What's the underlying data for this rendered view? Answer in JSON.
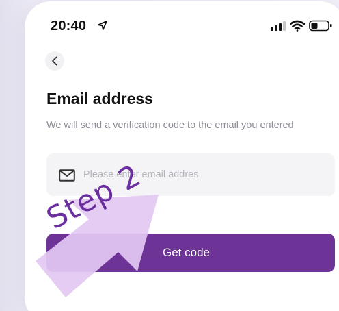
{
  "status_bar": {
    "time": "20:40",
    "location_icon": "location-arrow-icon",
    "signal_icon": "cellular-signal-icon",
    "wifi_icon": "wifi-icon",
    "battery_icon": "battery-icon"
  },
  "header": {
    "back_icon": "chevron-left-icon"
  },
  "main": {
    "title": "Email address",
    "subtitle": "We will send a verification code to the email you entered",
    "email_field": {
      "icon": "mail-icon",
      "value": "",
      "placeholder": "Please enter email addres"
    },
    "get_code_label": "Get code"
  },
  "annotation": {
    "label": "Step 2",
    "color": "#6b2fa0",
    "arrow_color": "#e2c8f2"
  },
  "colors": {
    "accent": "#6d3396",
    "field_bg": "#f4f4f6",
    "subtitle": "#8c8c96"
  }
}
